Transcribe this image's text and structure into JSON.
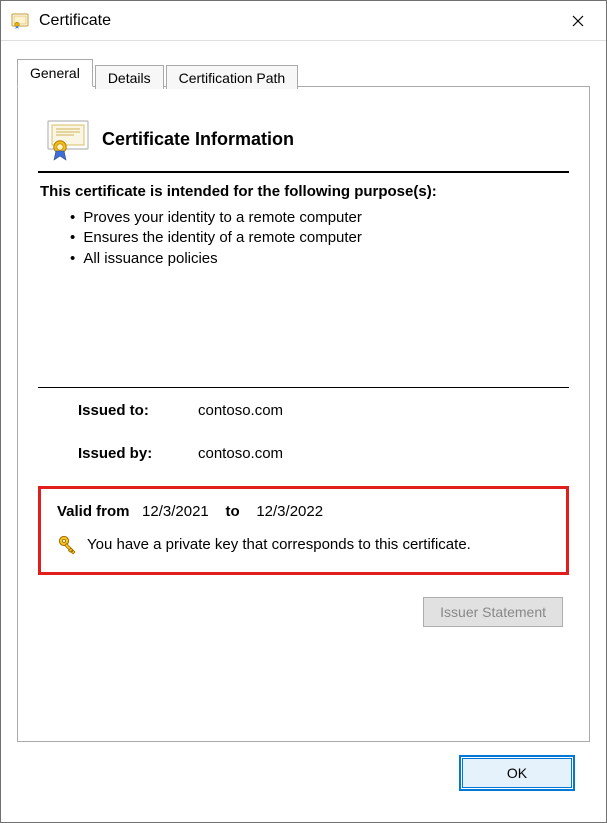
{
  "window": {
    "title": "Certificate"
  },
  "tabs": {
    "general": "General",
    "details": "Details",
    "path": "Certification Path"
  },
  "header": {
    "title": "Certificate Information"
  },
  "purpose": {
    "heading": "This certificate is intended for the following purpose(s):",
    "items": [
      "Proves your identity to a remote computer",
      "Ensures the identity of a remote computer",
      "All issuance policies"
    ]
  },
  "details": {
    "issued_to_label": "Issued to:",
    "issued_to_value": "contoso.com",
    "issued_by_label": "Issued by:",
    "issued_by_value": "contoso.com"
  },
  "validity": {
    "label_from": "Valid from",
    "from": "12/3/2021",
    "label_to": "to",
    "to": "12/3/2022"
  },
  "private_key_msg": "You have a private key that corresponds to this certificate.",
  "buttons": {
    "issuer_statement": "Issuer Statement",
    "ok": "OK"
  }
}
